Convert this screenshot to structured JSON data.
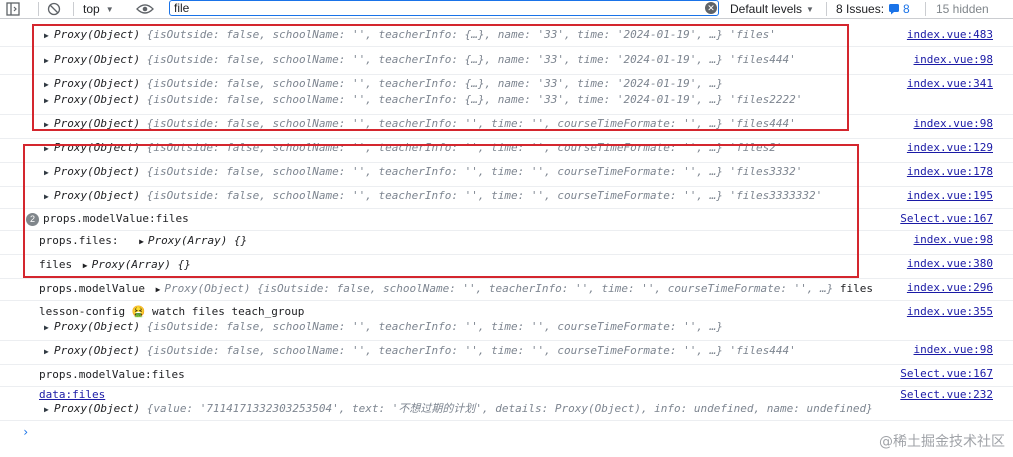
{
  "toolbar": {
    "context": "top",
    "filter_value": "file",
    "levels": "Default levels",
    "issues_label": "8 Issues:",
    "issues_count": "8",
    "hidden": "15 hidden"
  },
  "logs": {
    "l1": {
      "pre": "Proxy(Object) ",
      "rest": "{isOutside: false, schoolName: '', teacherInfo: {…}, name: '33', time: '2024-01-19', …} 'files'",
      "src": "index.vue:483"
    },
    "l2": {
      "pre": "Proxy(Object) ",
      "rest": "{isOutside: false, schoolName: '', teacherInfo: {…}, name: '33', time: '2024-01-19', …} 'files444'",
      "src": "index.vue:98"
    },
    "l3a": {
      "pre": "Proxy(Object) ",
      "rest": "{isOutside: false, schoolName: '', teacherInfo: {…}, name: '33', time: '2024-01-19', …}",
      "src": "index.vue:341"
    },
    "l3b": {
      "pre": "Proxy(Object) ",
      "rest": "{isOutside: false, schoolName: '', teacherInfo: {…}, name: '33', time: '2024-01-19', …} 'files2222'"
    },
    "l4": {
      "pre": "Proxy(Object) ",
      "rest": "{isOutside: false, schoolName: '', teacherInfo: '', time: '', courseTimeFormate: '', …} 'files444'",
      "src": "index.vue:98"
    },
    "l5": {
      "pre": "Proxy(Object) ",
      "rest": "{isOutside: false, schoolName: '', teacherInfo: '', time: '', courseTimeFormate: '', …} 'files2'",
      "src": "index.vue:129"
    },
    "l6": {
      "pre": "Proxy(Object) ",
      "rest": "{isOutside: false, schoolName: '', teacherInfo: '', time: '', courseTimeFormate: '', …} 'files3332'",
      "src": "index.vue:178"
    },
    "l7": {
      "pre": "Proxy(Object) ",
      "rest": "{isOutside: false, schoolName: '', teacherInfo: '', time: '', courseTimeFormate: '', …} 'files3333332'",
      "src": "index.vue:195"
    },
    "l8": {
      "count": "2",
      "text": "props.modelValue:files",
      "src": "Select.vue:167"
    },
    "l9": {
      "text": "props.files: ",
      "obj": "Proxy(Array) {}",
      "src": "index.vue:98"
    },
    "l10": {
      "text": "files ",
      "obj": "Proxy(Array) {}",
      "src": "index.vue:380"
    },
    "l11": {
      "text": "props.modelValue ",
      "obj": "Proxy(Object) {isOutside: false, schoolName: '', teacherInfo: '', time: '', courseTimeFormate: '', …}",
      "tail": " files",
      "src": "index.vue:296"
    },
    "l12a": {
      "text": "lesson-config 🤮 watch files  teach_group",
      "src": "index.vue:355"
    },
    "l12b": {
      "pre": "Proxy(Object) ",
      "rest": "{isOutside: false, schoolName: '', teacherInfo: '', time: '', courseTimeFormate: '', …}"
    },
    "l13": {
      "pre": "Proxy(Object) ",
      "rest": "{isOutside: false, schoolName: '', teacherInfo: '', time: '', courseTimeFormate: '', …} 'files444'",
      "src": "index.vue:98"
    },
    "l14": {
      "text": "props.modelValue:files",
      "src": "Select.vue:167"
    },
    "l15a": {
      "text": "data:files",
      "src": "Select.vue:232"
    },
    "l15b": {
      "pre": "Proxy(Object) ",
      "rest": "{value: '7114171332303253504', text: '不想过期的计划', details: Proxy(Object), info: undefined, name: undefined}"
    }
  },
  "watermark": "@稀土掘金技术社区",
  "colors": {
    "accent": "#1a73e8",
    "highlight_box": "#d4262e",
    "string": "#c80000",
    "keyword": "#1a1aa6"
  }
}
